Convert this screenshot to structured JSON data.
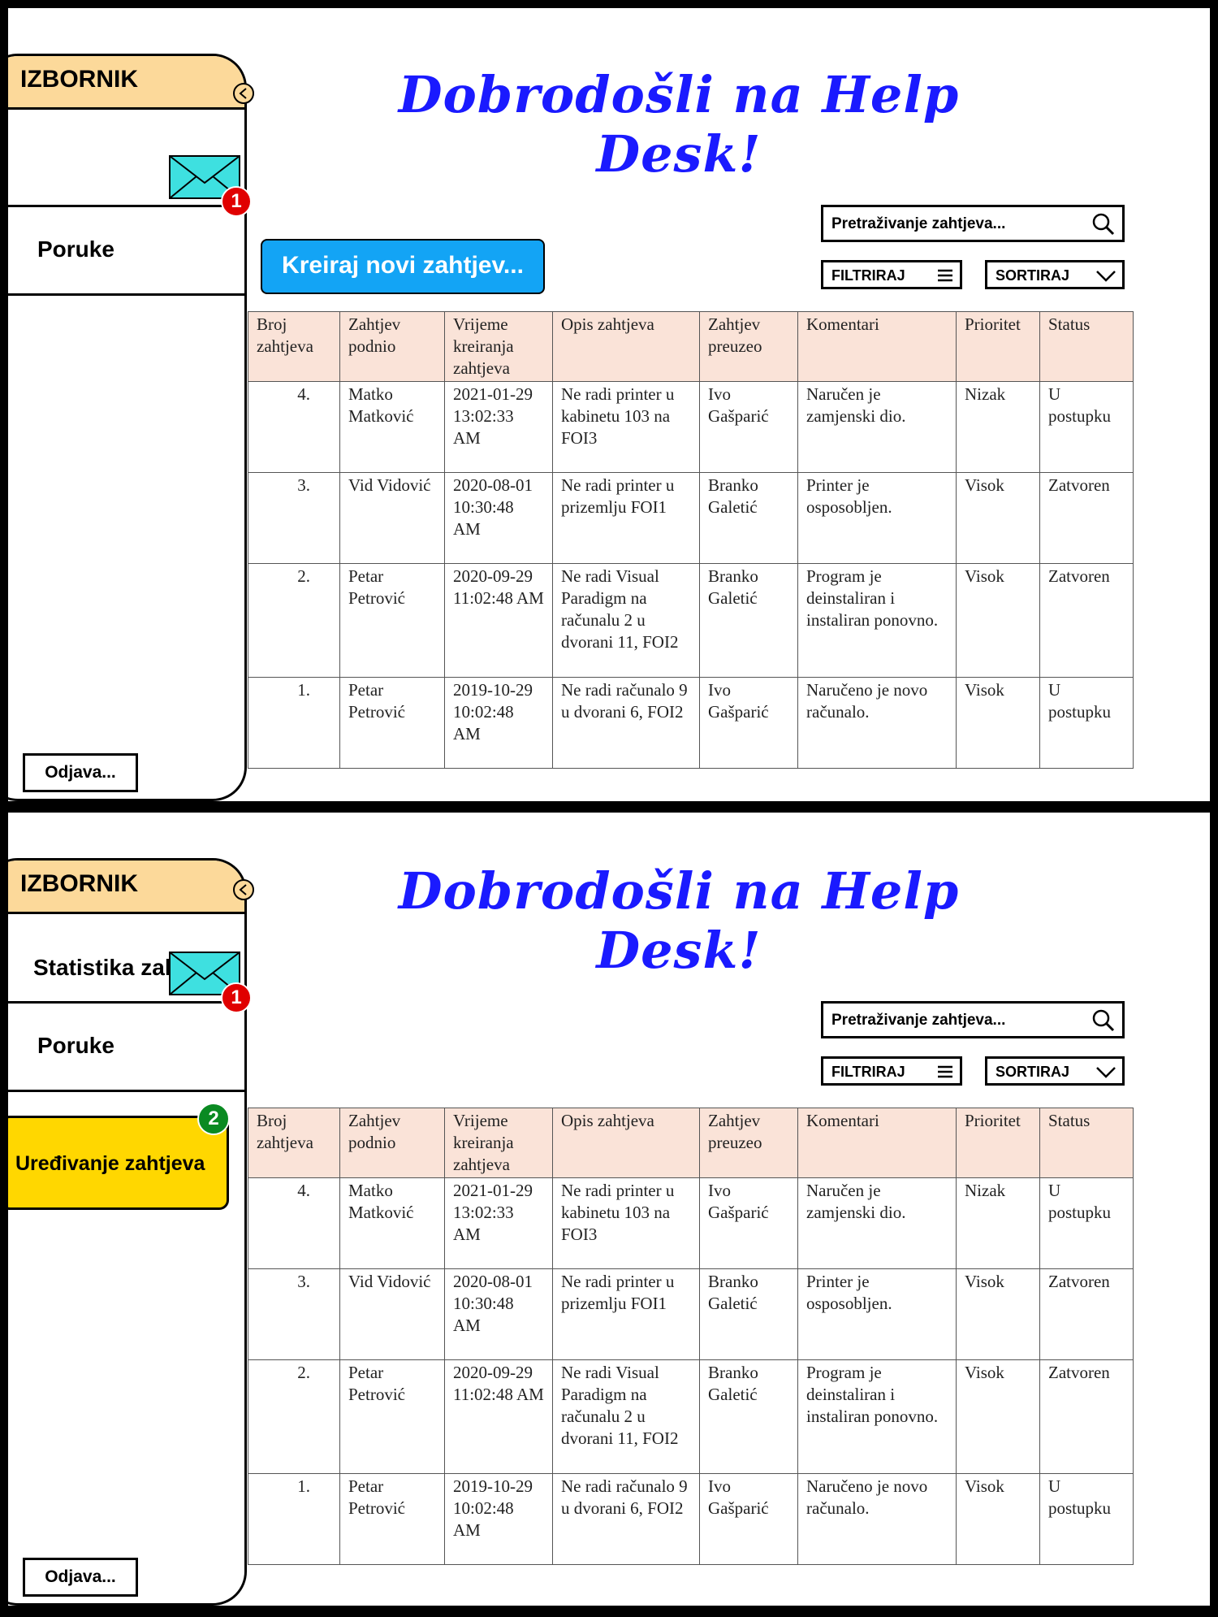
{
  "colors": {
    "menu_header": "#fcd99a",
    "title_text": "#1a1aff",
    "create_button": "#13a4f5",
    "edit_button": "#ffd700",
    "badge_red": "#e00000",
    "badge_green": "#0a8a22",
    "table_header": "#fae3d8",
    "mail_icon": "#3ee0e0"
  },
  "icons": [
    "chevron-left-icon",
    "mail-icon",
    "search-icon",
    "hamburger-icon",
    "chevron-down-icon"
  ],
  "screen1": {
    "menu": {
      "title": "IZBORNIK",
      "messages_label": "Poruke",
      "messages_badge": "1",
      "logout_label": "Odjava..."
    },
    "welcome": "Dobrodošli na Help Desk!",
    "create_button_label": "Kreiraj novi zahtjev...",
    "search_placeholder": "Pretraživanje zahtjeva...",
    "filter_label": "FILTRIRAJ",
    "sort_label": "SORTIRAJ"
  },
  "screen2": {
    "menu": {
      "title": "IZBORNIK",
      "statistics_label": "Statistika zahtjeva",
      "messages_label": "Poruke",
      "messages_badge": "1",
      "edit_label": "Uređivanje zahtjeva",
      "edit_badge": "2",
      "logout_label": "Odjava..."
    },
    "welcome": "Dobrodošli na Help Desk!",
    "search_placeholder": "Pretraživanje zahtjeva...",
    "filter_label": "FILTRIRAJ",
    "sort_label": "SORTIRAJ"
  },
  "table": {
    "headers": [
      "Broj zahtjeva",
      "Zahtjev podnio",
      "Vrijeme kreiranja zahtjeva",
      "Opis zahtjeva",
      "Zahtjev preuzeo",
      "Komentari",
      "Prioritet",
      "Status"
    ],
    "rows": [
      [
        "4.",
        "Matko Matković",
        "2021-01-29 13:02:33 AM",
        "Ne radi printer u kabinetu 103 na FOI3",
        "Ivo Gašparić",
        "Naručen je zamjenski dio.",
        "Nizak",
        "U postupku"
      ],
      [
        "3.",
        "Vid Vidović",
        "2020-08-01 10:30:48 AM",
        "Ne radi printer u prizemlju FOI1",
        "Branko Galetić",
        "Printer je osposobljen.",
        "Visok",
        "Zatvoren"
      ],
      [
        "2.",
        "Petar Petrović",
        "2020-09-29 11:02:48 AM",
        "Ne radi Visual Paradigm na računalu 2 u dvorani 11, FOI2",
        "Branko Galetić",
        "Program je deinstaliran i instaliran ponovno.",
        "Visok",
        "Zatvoren"
      ],
      [
        "1.",
        "Petar Petrović",
        "2019-10-29 10:02:48 AM",
        "Ne radi računalo 9 u dvorani 6, FOI2",
        "Ivo Gašparić",
        "Naručeno je novo računalo.",
        "Visok",
        "U postupku"
      ]
    ]
  }
}
